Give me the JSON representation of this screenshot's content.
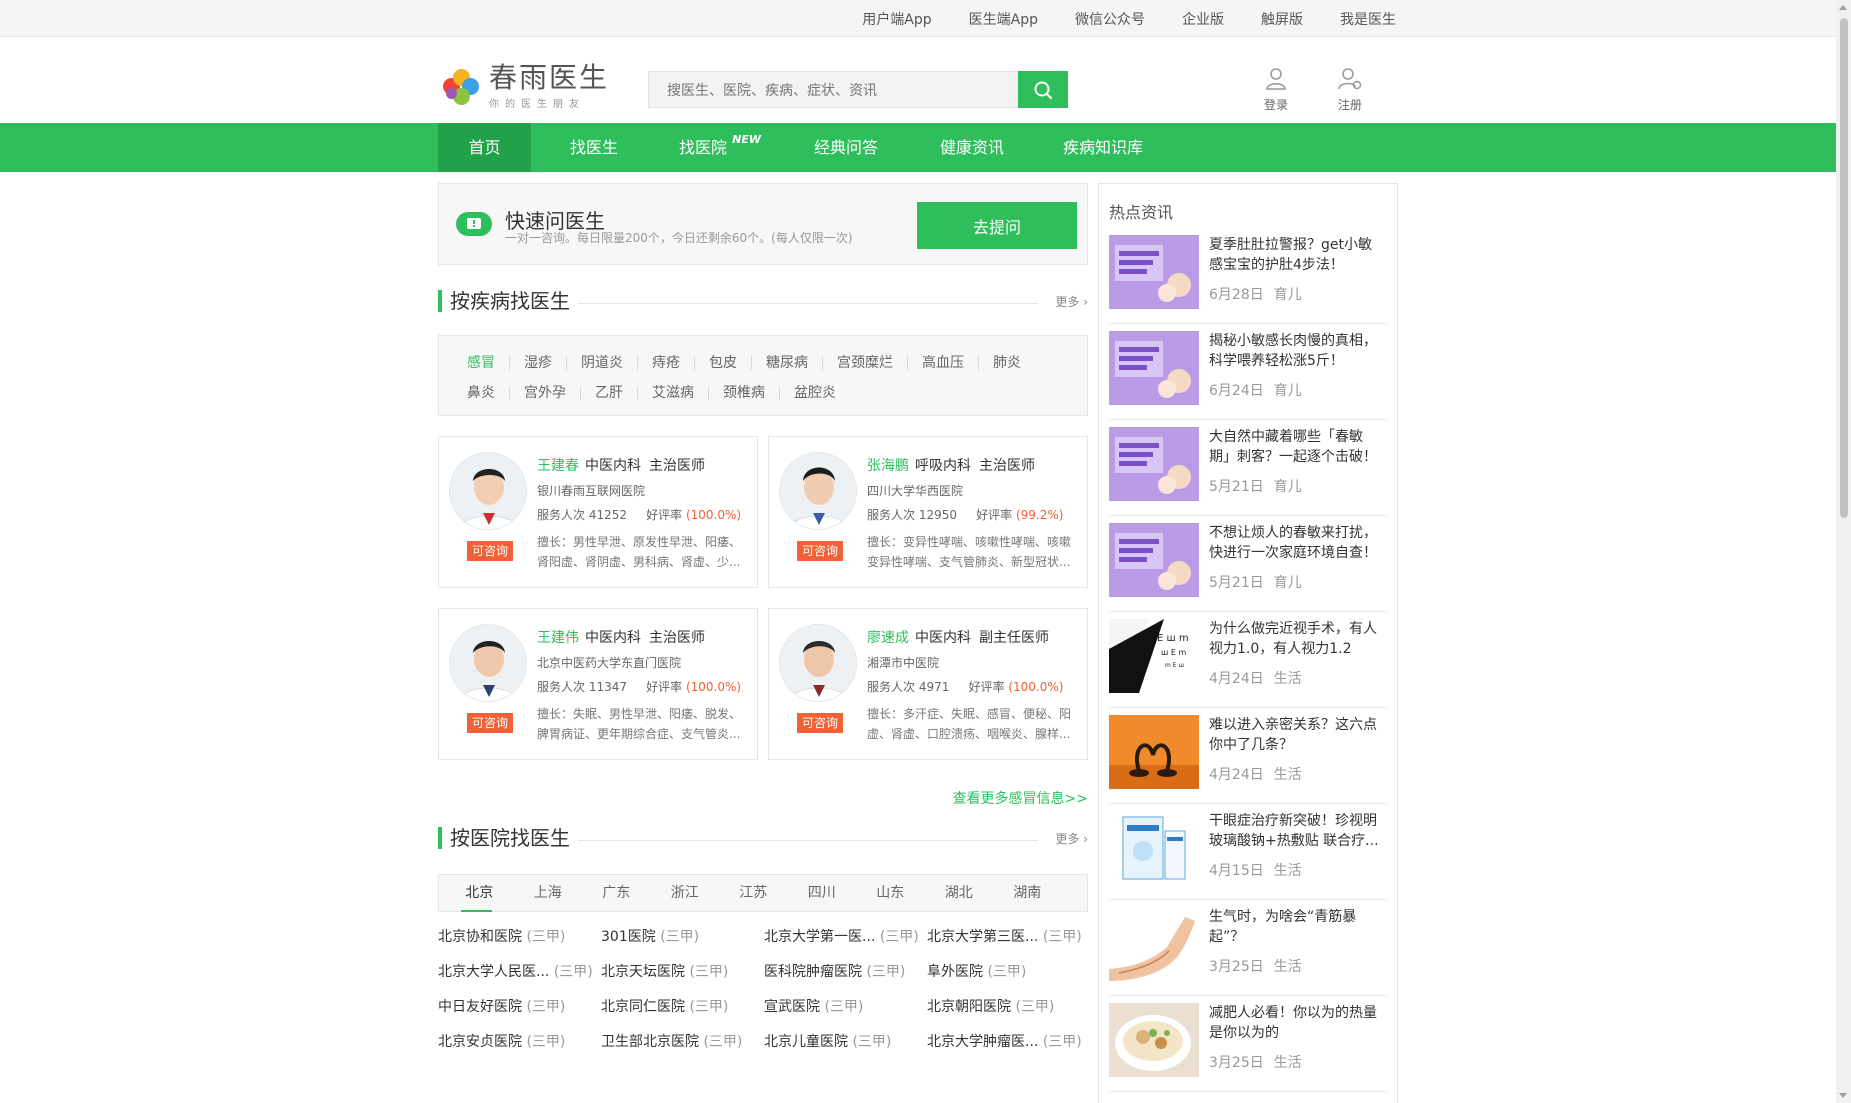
{
  "topbar": {
    "links": [
      "用户端App",
      "医生端App",
      "微信公众号",
      "企业版",
      "触屏版",
      "我是医生"
    ]
  },
  "header": {
    "logo_title": "春雨医生",
    "logo_sub": "你的医生朋友",
    "search_placeholder": "搜医生、医院、疾病、症状、资讯",
    "login": "登录",
    "register": "注册"
  },
  "nav": {
    "items": [
      "首页",
      "找医生",
      "找医院",
      "经典问答",
      "健康资讯",
      "疾病知识库"
    ],
    "badge": "NEW"
  },
  "quick_ask": {
    "title": "快速问医生",
    "desc": "一对一咨询。每日限量200个，今日还剩余60个。(每人仅限一次)",
    "button": "去提问"
  },
  "disease_section": {
    "title": "按疾病找医生",
    "more": "更多",
    "tags_row1": [
      "感冒",
      "湿疹",
      "阴道炎",
      "痔疮",
      "包皮",
      "糖尿病",
      "宫颈糜烂",
      "高血压",
      "肺炎"
    ],
    "tags_row2": [
      "鼻炎",
      "宫外孕",
      "乙肝",
      "艾滋病",
      "颈椎病",
      "盆腔炎"
    ]
  },
  "doctors": [
    {
      "name": "王建春",
      "dept": "中医内科",
      "title": "主治医师",
      "hospital": "银川春雨互联网医院",
      "service_label": "服务人次",
      "service": "41252",
      "rate_label": "好评率",
      "rate": "100.0%",
      "good_at": "擅长：男性早泄、原发性早泄、阳痿、肾阳虚、肾阴虚、男科病、肾虚、少...",
      "tag": "可咨询"
    },
    {
      "name": "张海鹏",
      "dept": "呼吸内科",
      "title": "主治医师",
      "hospital": "四川大学华西医院",
      "service_label": "服务人次",
      "service": "12950",
      "rate_label": "好评率",
      "rate": "99.2%",
      "good_at": "擅长：变异性哮喘、咳嗽性哮喘、咳嗽变异性哮喘、支气管肺炎、新型冠状...",
      "tag": "可咨询"
    },
    {
      "name": "王建伟",
      "dept": "中医内科",
      "title": "主治医师",
      "hospital": "北京中医药大学东直门医院",
      "service_label": "服务人次",
      "service": "11347",
      "rate_label": "好评率",
      "rate": "100.0%",
      "good_at": "擅长：失眠、男性早泄、阳痿、脱发、脾胃病证、更年期综合症、支气管炎...",
      "tag": "可咨询"
    },
    {
      "name": "廖速成",
      "dept": "中医内科",
      "title": "副主任医师",
      "hospital": "湘潭市中医院",
      "service_label": "服务人次",
      "service": "4971",
      "rate_label": "好评率",
      "rate": "100.0%",
      "good_at": "擅长：多汗症、失眠、感冒、便秘、阳虚、肾虚、口腔溃疡、咽喉炎、腺样...",
      "tag": "可咨询"
    }
  ],
  "view_more": "查看更多感冒信息>>",
  "hospital_section": {
    "title": "按医院找医生",
    "more": "更多",
    "provinces": [
      "北京",
      "上海",
      "广东",
      "浙江",
      "江苏",
      "四川",
      "山东",
      "湖北",
      "湖南"
    ],
    "hospitals": [
      {
        "name": "北京协和医院",
        "level": "(三甲)"
      },
      {
        "name": "301医院",
        "level": "(三甲)"
      },
      {
        "name": "北京大学第一医...",
        "level": "(三甲)"
      },
      {
        "name": "北京大学第三医...",
        "level": "(三甲)"
      },
      {
        "name": "北京大学人民医...",
        "level": "(三甲)"
      },
      {
        "name": "北京天坛医院",
        "level": "(三甲)"
      },
      {
        "name": "医科院肿瘤医院",
        "level": "(三甲)"
      },
      {
        "name": "阜外医院",
        "level": "(三甲)"
      },
      {
        "name": "中日友好医院",
        "level": "(三甲)"
      },
      {
        "name": "北京同仁医院",
        "level": "(三甲)"
      },
      {
        "name": "宣武医院",
        "level": "(三甲)"
      },
      {
        "name": "北京朝阳医院",
        "level": "(三甲)"
      },
      {
        "name": "北京安贞医院",
        "level": "(三甲)"
      },
      {
        "name": "卫生部北京医院",
        "level": "(三甲)"
      },
      {
        "name": "北京儿童医院",
        "level": "(三甲)"
      },
      {
        "name": "北京大学肿瘤医...",
        "level": "(三甲)"
      }
    ]
  },
  "sidebar": {
    "title": "热点资讯",
    "news": [
      {
        "title": "夏季肚肚拉警报？get小敏感宝宝的护肚4步法！",
        "date": "6月28日",
        "category": "育儿",
        "thumb": "purple"
      },
      {
        "title": "揭秘小敏感长肉慢的真相，科学喂养轻松涨5斤！",
        "date": "6月24日",
        "category": "育儿",
        "thumb": "purple"
      },
      {
        "title": "大自然中藏着哪些「春敏期」刺客？一起逐个击破！",
        "date": "5月21日",
        "category": "育儿",
        "thumb": "purple"
      },
      {
        "title": "不想让烦人的春敏来打扰，快进行一次家庭环境自查！",
        "date": "5月21日",
        "category": "育儿",
        "thumb": "purple"
      },
      {
        "title": "为什么做完近视手术，有人视力1.0，有人视力1.2",
        "date": "4月24日",
        "category": "生活",
        "thumb": "eye"
      },
      {
        "title": "难以进入亲密关系？这六点你中了几条？",
        "date": "4月24日",
        "category": "生活",
        "thumb": "swan"
      },
      {
        "title": "干眼症治疗新突破！珍视明玻璃酸钠+热敷贴 联合疗...",
        "date": "4月15日",
        "category": "生活",
        "thumb": "box"
      },
      {
        "title": "生气时，为啥会“青筋暴起”？",
        "date": "3月25日",
        "category": "生活",
        "thumb": "arm"
      },
      {
        "title": "减肥人必看！你以为的热量是你以为的",
        "date": "3月25日",
        "category": "生活",
        "thumb": "food"
      }
    ]
  },
  "colors": {
    "brand": "#2fbe5c",
    "accent": "#f06235"
  }
}
